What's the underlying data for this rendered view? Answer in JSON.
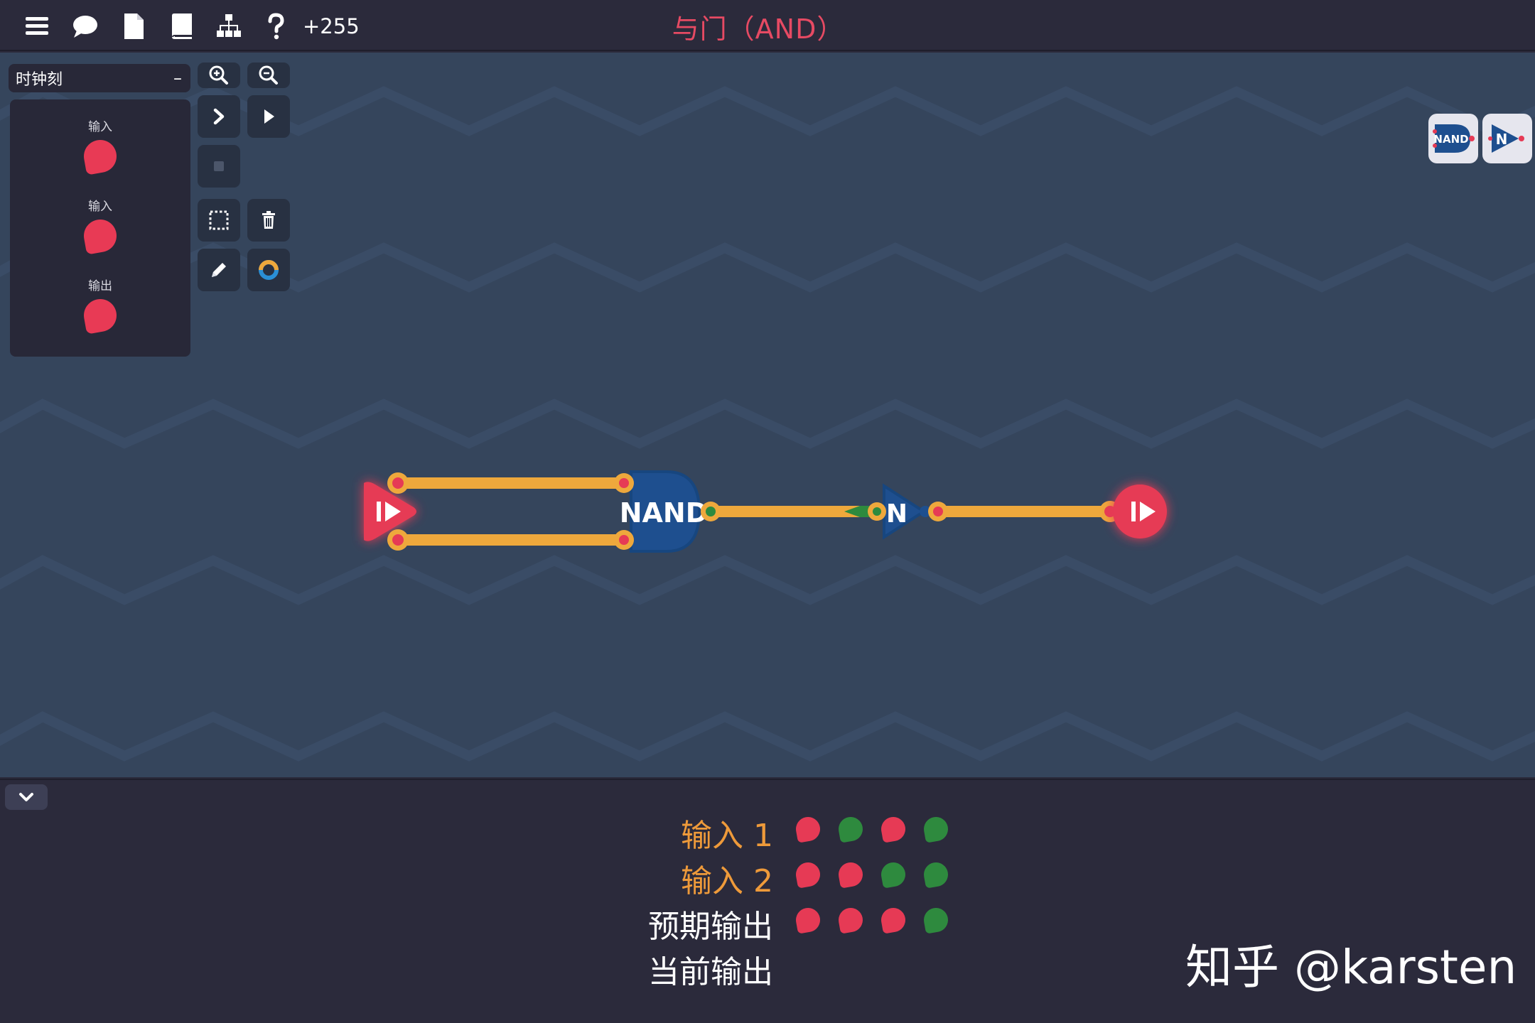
{
  "topbar": {
    "score": "+255",
    "title": "与门（AND）"
  },
  "panel": {
    "header": "时钟刻",
    "collapse_symbol": "–",
    "items": [
      {
        "label": "输入"
      },
      {
        "label": "输入"
      },
      {
        "label": "输出"
      }
    ]
  },
  "palette": {
    "nand_label": "NAND",
    "not_label": "N"
  },
  "circuit": {
    "nand_label": "NAND",
    "not_label": "N"
  },
  "truth_table": {
    "rows": [
      {
        "label": "输入 1",
        "values": [
          "red",
          "green",
          "red",
          "green"
        ]
      },
      {
        "label": "输入 2",
        "values": [
          "red",
          "red",
          "green",
          "green"
        ]
      },
      {
        "label": "预期输出",
        "values": [
          "red",
          "red",
          "red",
          "green"
        ]
      },
      {
        "label": "当前输出",
        "values": []
      }
    ]
  },
  "colors": {
    "on": "#2e8a3e",
    "off": "#e63a55",
    "wire": "#eea83c",
    "gate": "#1e4f8f",
    "title": "#e64a63"
  },
  "watermark": "知乎 @karsten"
}
